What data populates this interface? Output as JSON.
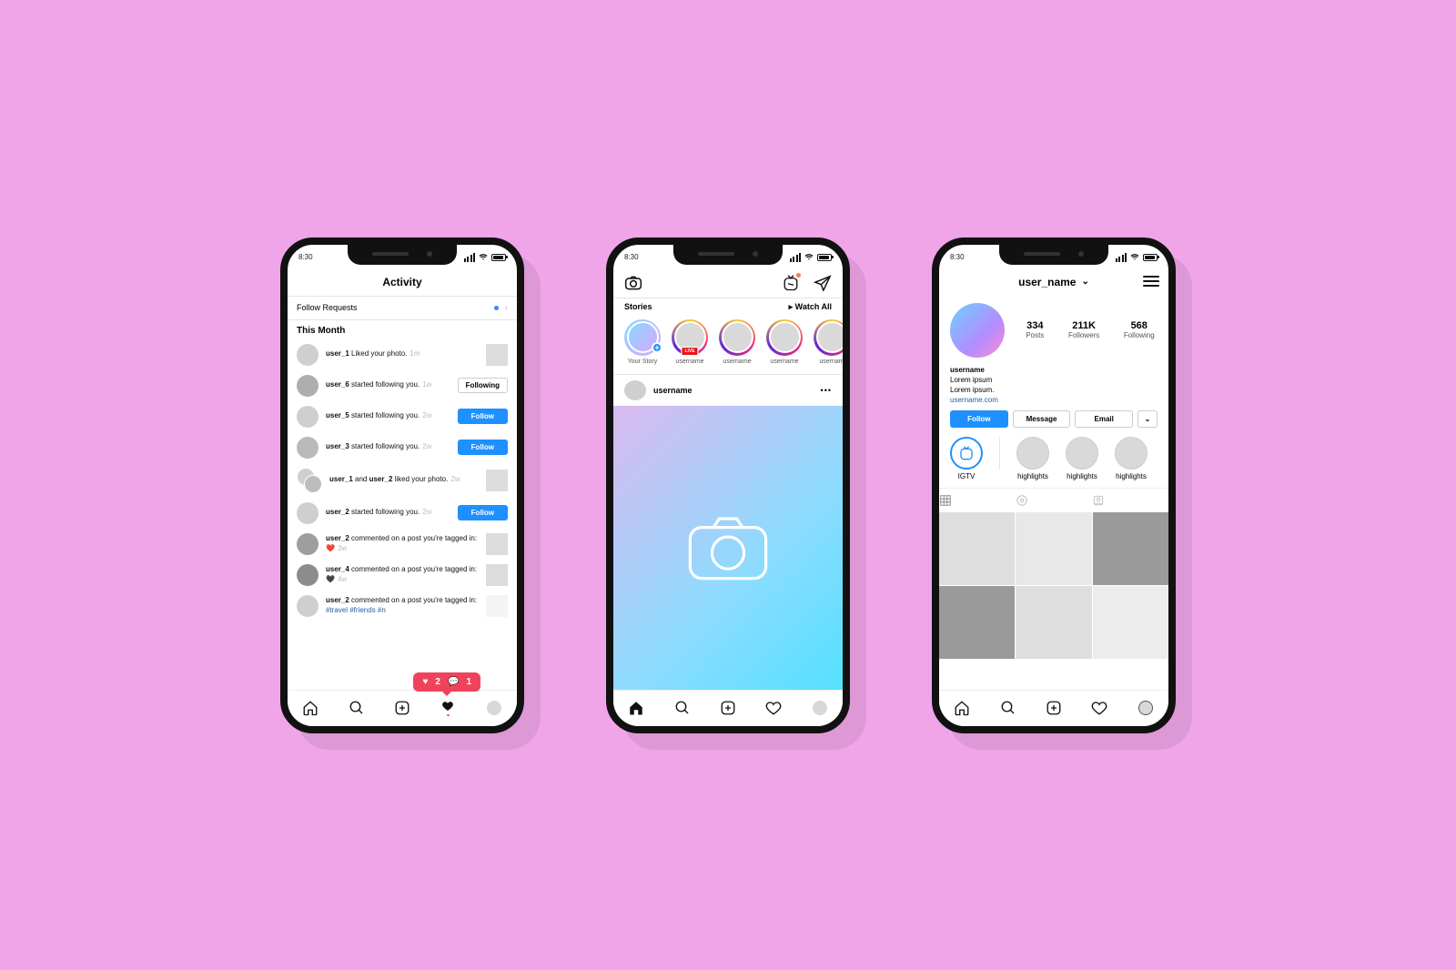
{
  "status_time": "8:30",
  "activity": {
    "title": "Activity",
    "follow_requests": "Follow Requests",
    "this_month": "This Month",
    "items": [
      {
        "user": "user_1",
        "action": "Liked your photo.",
        "time": "1m",
        "right": "thumb"
      },
      {
        "user": "user_6",
        "action": "started following you.",
        "time": "1w",
        "right": "following"
      },
      {
        "user": "user_5",
        "action": "started following you.",
        "time": "2w",
        "right": "follow"
      },
      {
        "user": "user_3",
        "action": "started following you.",
        "time": "2w",
        "right": "follow"
      },
      {
        "dual": true,
        "user": "user_1",
        "user2": "user_2",
        "action": "liked your photo.",
        "time": "2w",
        "right": "thumb"
      },
      {
        "user": "user_2",
        "action": "started following you.",
        "time": "2w",
        "right": "follow"
      },
      {
        "user": "user_2",
        "action": "commented on a post you're tagged in:",
        "emoji": "❤️",
        "time": "3w",
        "right": "thumb"
      },
      {
        "user": "user_4",
        "action": "commented on a post you're tagged in:",
        "emoji": "🖤",
        "time": "4w",
        "right": "thumb"
      },
      {
        "user": "user_2",
        "action": "commented on a post you're tagged in:",
        "hashtags": "#travel #friends #n",
        "right": "thumb"
      }
    ],
    "following_label": "Following",
    "follow_label": "Follow",
    "noti": {
      "likes": "2",
      "comments": "1"
    }
  },
  "feed": {
    "stories_label": "Stories",
    "watch_all": "▸ Watch All",
    "your_story": "Your Story",
    "live": "LIVE",
    "story_users": [
      "username",
      "username",
      "username",
      "usernam"
    ],
    "post_user": "username"
  },
  "profile": {
    "handle": "user_name",
    "stats": [
      {
        "n": "334",
        "l": "Posts"
      },
      {
        "n": "211K",
        "l": "Followers"
      },
      {
        "n": "568",
        "l": "Following"
      }
    ],
    "bio_name": "username",
    "bio_line1": "Lorem ipsum",
    "bio_line2": "Lorem ipsum.",
    "bio_link": "username.com",
    "btn_follow": "Follow",
    "btn_message": "Message",
    "btn_email": "Email",
    "igtv_label": "IGTV",
    "highlights_label": "highlights"
  }
}
